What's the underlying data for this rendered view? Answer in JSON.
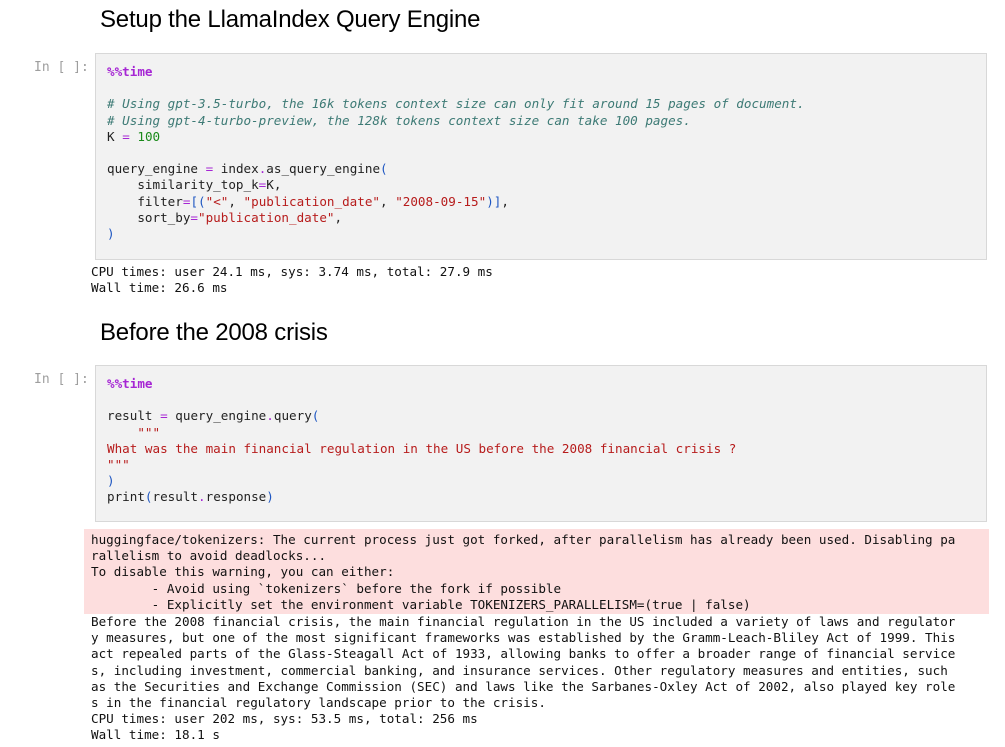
{
  "headings": {
    "setup": "Setup the LlamaIndex Query Engine",
    "crisis": "Before the 2008 crisis"
  },
  "cells": [
    {
      "prompt": "In [ ]:",
      "magic": "%%time",
      "comment_1": "# Using gpt-3.5-turbo, the 16k tokens context size can only fit around 15 pages of document.",
      "comment_2": "# Using gpt-4-turbo-preview, the 128k tokens context size can take 100 pages.",
      "k_name": "K",
      "k_value": "100",
      "qe_lhs": "query_engine",
      "qe_rhs": "index",
      "qe_method": "as_query_engine",
      "arg_top_k_name": "similarity_top_k",
      "arg_top_k_value": "K",
      "arg_filter_name": "filter",
      "filter_op": "\"<\"",
      "filter_field": "\"publication_date\"",
      "filter_date": "\"2008-09-15\"",
      "arg_sort_name": "sort_by",
      "arg_sort_value": "\"publication_date\"",
      "output_lines": [
        "CPU times: user 24.1 ms, sys: 3.74 ms, total: 27.9 ms",
        "Wall time: 26.6 ms"
      ]
    },
    {
      "prompt": "In [ ]:",
      "magic": "%%time",
      "result_lhs": "result",
      "result_obj": "query_engine",
      "result_method": "query",
      "triple_quote": "\"\"\"",
      "question": "What was the main financial regulation in the US before the 2008 financial crisis ?",
      "print_fn": "print",
      "print_obj": "result",
      "print_attr": "response",
      "stderr_lines": [
        "huggingface/tokenizers: The current process just got forked, after parallelism has already been used. Disabling pa",
        "rallelism to avoid deadlocks...",
        "To disable this warning, you can either:",
        "        - Avoid using `tokenizers` before the fork if possible",
        "        - Explicitly set the environment variable TOKENIZERS_PARALLELISM=(true | false)"
      ],
      "output_lines": [
        "Before the 2008 financial crisis, the main financial regulation in the US included a variety of laws and regulator",
        "y measures, but one of the most significant frameworks was established by the Gramm-Leach-Bliley Act of 1999. This",
        "act repealed parts of the Glass-Steagall Act of 1933, allowing banks to offer a broader range of financial service",
        "s, including investment, commercial banking, and insurance services. Other regulatory measures and entities, such",
        "as the Securities and Exchange Commission (SEC) and laws like the Sarbanes-Oxley Act of 2002, also played key role",
        "s in the financial regulatory landscape prior to the crisis.",
        "CPU times: user 202 ms, sys: 53.5 ms, total: 256 ms",
        "Wall time: 18.1 s"
      ]
    }
  ],
  "colors": {
    "magic": "#a626d4",
    "comment": "#3d7a75",
    "number": "#1a8a1a",
    "string": "#b71c1c",
    "paren": "#1f57c2",
    "stderr_bg": "#fddede",
    "cell_bg": "#f2f2f2",
    "prompt": "#9e9e9e"
  }
}
